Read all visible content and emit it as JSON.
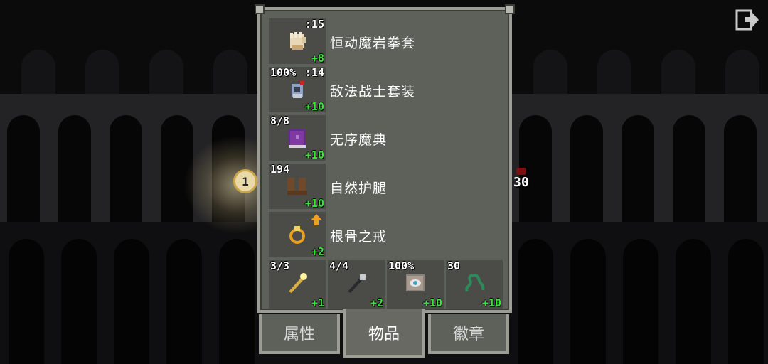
{
  "hud": {
    "exit_icon": "exit-icon",
    "hero_level": "1",
    "enemy_level": "30"
  },
  "inventory": {
    "items": [
      {
        "name": "恒动魔岩拳套",
        "top_left": "",
        "top_right": ":15",
        "bonus": "+8",
        "icon": "gauntlet-icon",
        "color": "#e8d8b8"
      },
      {
        "name": "敌法战士套装",
        "top_left": "100%",
        "top_right": ":14",
        "bonus": "+10",
        "icon": "armor-icon",
        "color": "#8fa3c8"
      },
      {
        "name": "无序魔典",
        "top_left": "8/8",
        "top_right": "",
        "bonus": "+10",
        "icon": "tome-icon",
        "color": "#6a2a8a"
      },
      {
        "name": "自然护腿",
        "top_left": "194",
        "top_right": "",
        "bonus": "+10",
        "icon": "boots-icon",
        "color": "#6e4a2a"
      },
      {
        "name": "根骨之戒",
        "top_left": "",
        "top_right": "",
        "bonus": "+2",
        "icon": "ring-icon",
        "color": "#e8a020",
        "upgrade_icon": "upgrade-arrow-icon"
      }
    ],
    "quickslots": [
      {
        "top_left": "3/3",
        "bonus": "+1",
        "icon": "wand-gold-icon",
        "color": "#f0d060"
      },
      {
        "top_left": "4/4",
        "bonus": "+2",
        "icon": "wand-dark-icon",
        "color": "#9aa0a6"
      },
      {
        "top_left": "100%",
        "bonus": "+10",
        "icon": "artifact-eye-icon",
        "color": "#c8c0b8"
      },
      {
        "top_left": "30",
        "bonus": "+10",
        "icon": "chain-icon",
        "color": "#2e8a5a"
      }
    ]
  },
  "tabs": [
    {
      "label": "属性"
    },
    {
      "label": "物品"
    },
    {
      "label": "徽章"
    }
  ],
  "colors": {
    "bonus_green": "#38e43a",
    "window_bg": "#5e605a",
    "slot_bg": "#4b4c48"
  }
}
